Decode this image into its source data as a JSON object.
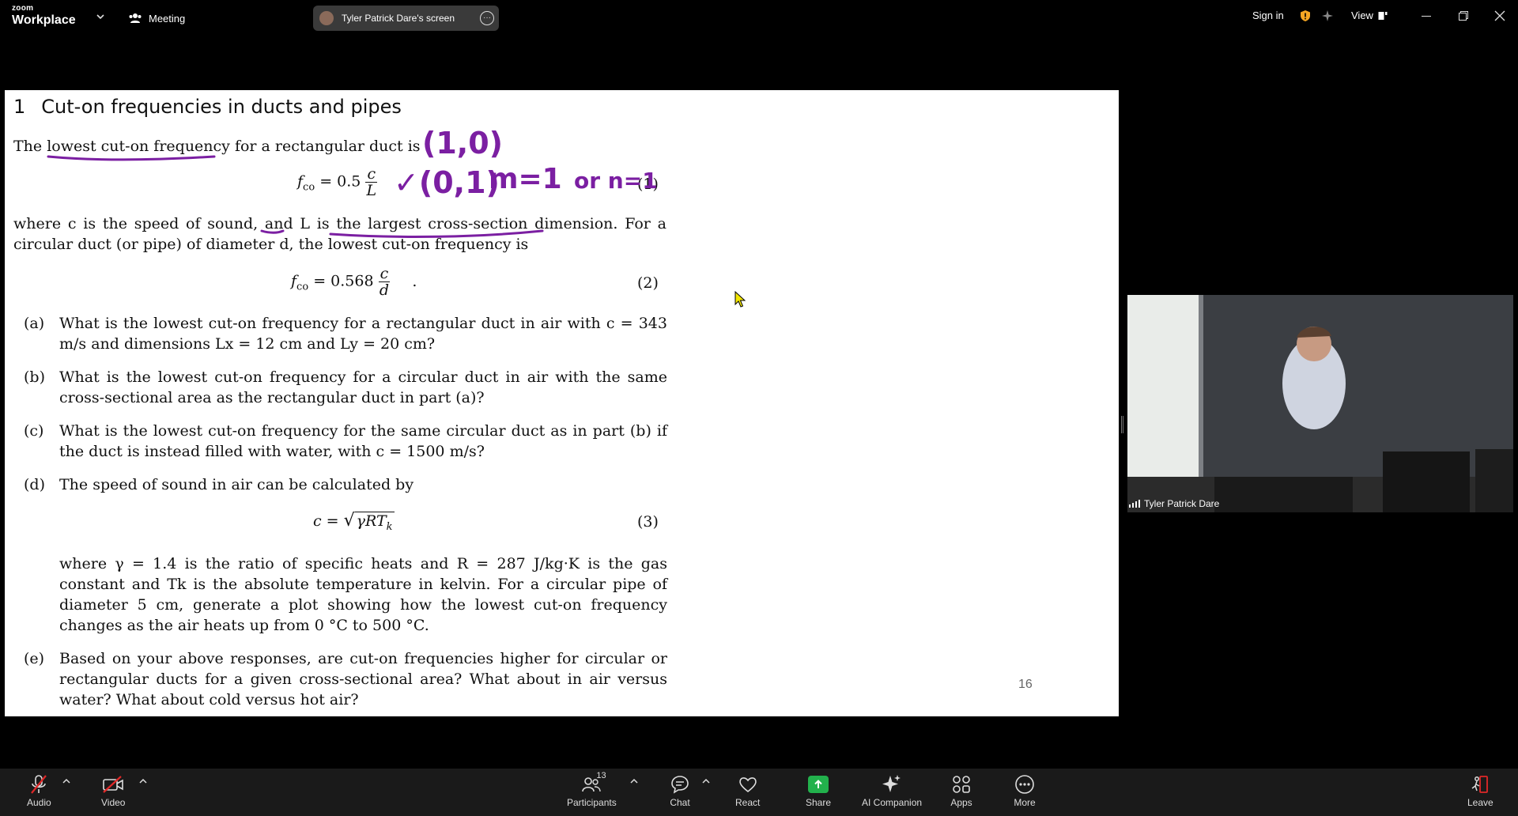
{
  "app": {
    "brand_top": "zoom",
    "brand_bottom": "Workplace",
    "meeting_label": "Meeting",
    "screen_pill_label": "Tyler Patrick Dare's screen",
    "signin_label": "Sign in",
    "view_label": "View"
  },
  "slide": {
    "section_number": "1",
    "section_title": "Cut-on frequencies in ducts and pipes",
    "intro_a": "The ",
    "intro_underlined": "lowest cut-on frequency",
    "intro_b": " for a rectangular duct is",
    "eq1_lhs": "f",
    "eq1_sub": "co",
    "eq1_rhs": "= 0.5",
    "eq1_num": "c",
    "eq1_den": "L",
    "eq1_label": "(1)",
    "para2": "where c is the speed of sound, and L is the largest cross-section dimension. For a circular duct (or pipe) of diameter d, the lowest cut-on frequency is",
    "eq2_lhs": "f",
    "eq2_sub": "co",
    "eq2_rhs": "= 0.568",
    "eq2_num": "c",
    "eq2_den": "d",
    "eq2_tail": ".",
    "eq2_label": "(2)",
    "items": [
      {
        "label": "(a)",
        "text": "What is the lowest cut-on frequency for a rectangular duct in air with c = 343 m/s and dimensions Lx = 12 cm and Ly = 20 cm?"
      },
      {
        "label": "(b)",
        "text": "What is the lowest cut-on frequency for a circular duct in air with the same cross-sectional area as the rectangular duct in part (a)?"
      },
      {
        "label": "(c)",
        "text": "What is the lowest cut-on frequency for the same circular duct as in part (b) if the duct is instead filled with water, with c = 1500 m/s?"
      },
      {
        "label": "(d)",
        "text": "The speed of sound in air can be calculated by"
      },
      {
        "label": "(e)",
        "text": "Based on your above responses, are cut-on frequencies higher for circular or rectangular ducts for a given cross-sectional area? What about in air versus water? What about cold versus hot air?"
      }
    ],
    "eq3_lhs": "c = ",
    "eq3_rad": "γRT",
    "eq3_sub": "k",
    "eq3_label": "(3)",
    "item_d_cont": "where γ = 1.4 is the ratio of specific heats and R = 287 J/kg·K is the gas constant and Tk is the absolute temperature in kelvin. For a circular pipe of diameter 5 cm, generate a plot showing how the lowest cut-on frequency changes as the air heats up from 0 °C to 500 °C.",
    "page_number": "16",
    "annotations": [
      "(1,0)",
      "✓(0,1)",
      "m=1",
      "or n=1"
    ]
  },
  "video": {
    "participant_name": "Tyler Patrick Dare"
  },
  "toolbar": {
    "audio": "Audio",
    "video": "Video",
    "participants": "Participants",
    "participants_count": "13",
    "chat": "Chat",
    "react": "React",
    "share": "Share",
    "ai_companion": "AI Companion",
    "apps": "Apps",
    "more": "More",
    "leave": "Leave"
  },
  "colors": {
    "ink": "#7b1fa2",
    "share_green": "#22b14c",
    "leave_red": "#e02828",
    "shield_yellow": "#f5a623"
  }
}
